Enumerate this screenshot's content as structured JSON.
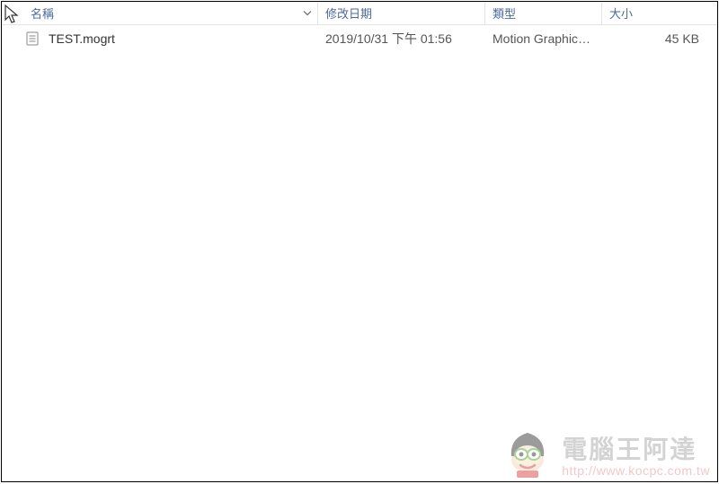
{
  "columns": {
    "name": "名稱",
    "date": "修改日期",
    "type": "類型",
    "size": "大小"
  },
  "files": [
    {
      "name": "TEST.mogrt",
      "date": "2019/10/31 下午 01:56",
      "type": "Motion Graphics ...",
      "size": "45 KB"
    }
  ],
  "watermark": {
    "title": "電腦王阿達",
    "url": "http://www.kocpc.com.tw"
  }
}
